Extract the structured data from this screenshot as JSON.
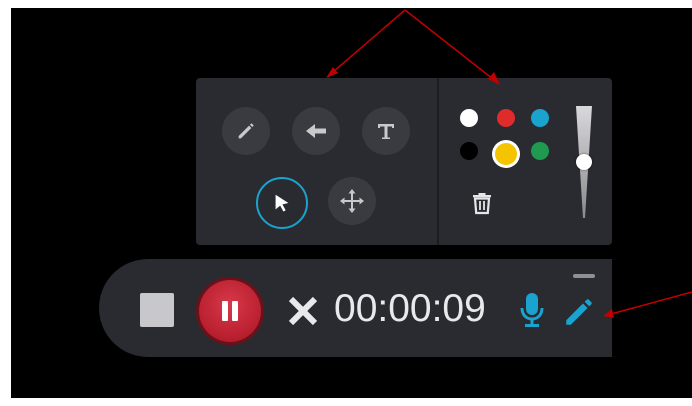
{
  "recorder": {
    "timer": "00:00:09",
    "state": "recording"
  },
  "annotation_tools": {
    "tools": [
      "pen",
      "arrow",
      "text",
      "select",
      "move"
    ],
    "active_tool": "select"
  },
  "palette": {
    "colors": [
      "#ffffff",
      "#e02b2b",
      "#1aa3cf",
      "#000000",
      "#f5c400",
      "#1f9a4f"
    ],
    "selected_color": "#f5c400"
  },
  "stroke_size": {
    "level": 0.5
  },
  "colors": {
    "accent": "#1aa3cf",
    "pause_red": "#c62a38",
    "panel_bg": "#2a2b30",
    "annotation_arrow": "#c10000"
  },
  "icons": {
    "stop": "stop-icon",
    "pause": "pause-icon",
    "cancel": "close-icon",
    "mic": "microphone-icon",
    "pen": "pencil-icon",
    "trash": "trash-icon",
    "minimize": "minimize-icon"
  }
}
